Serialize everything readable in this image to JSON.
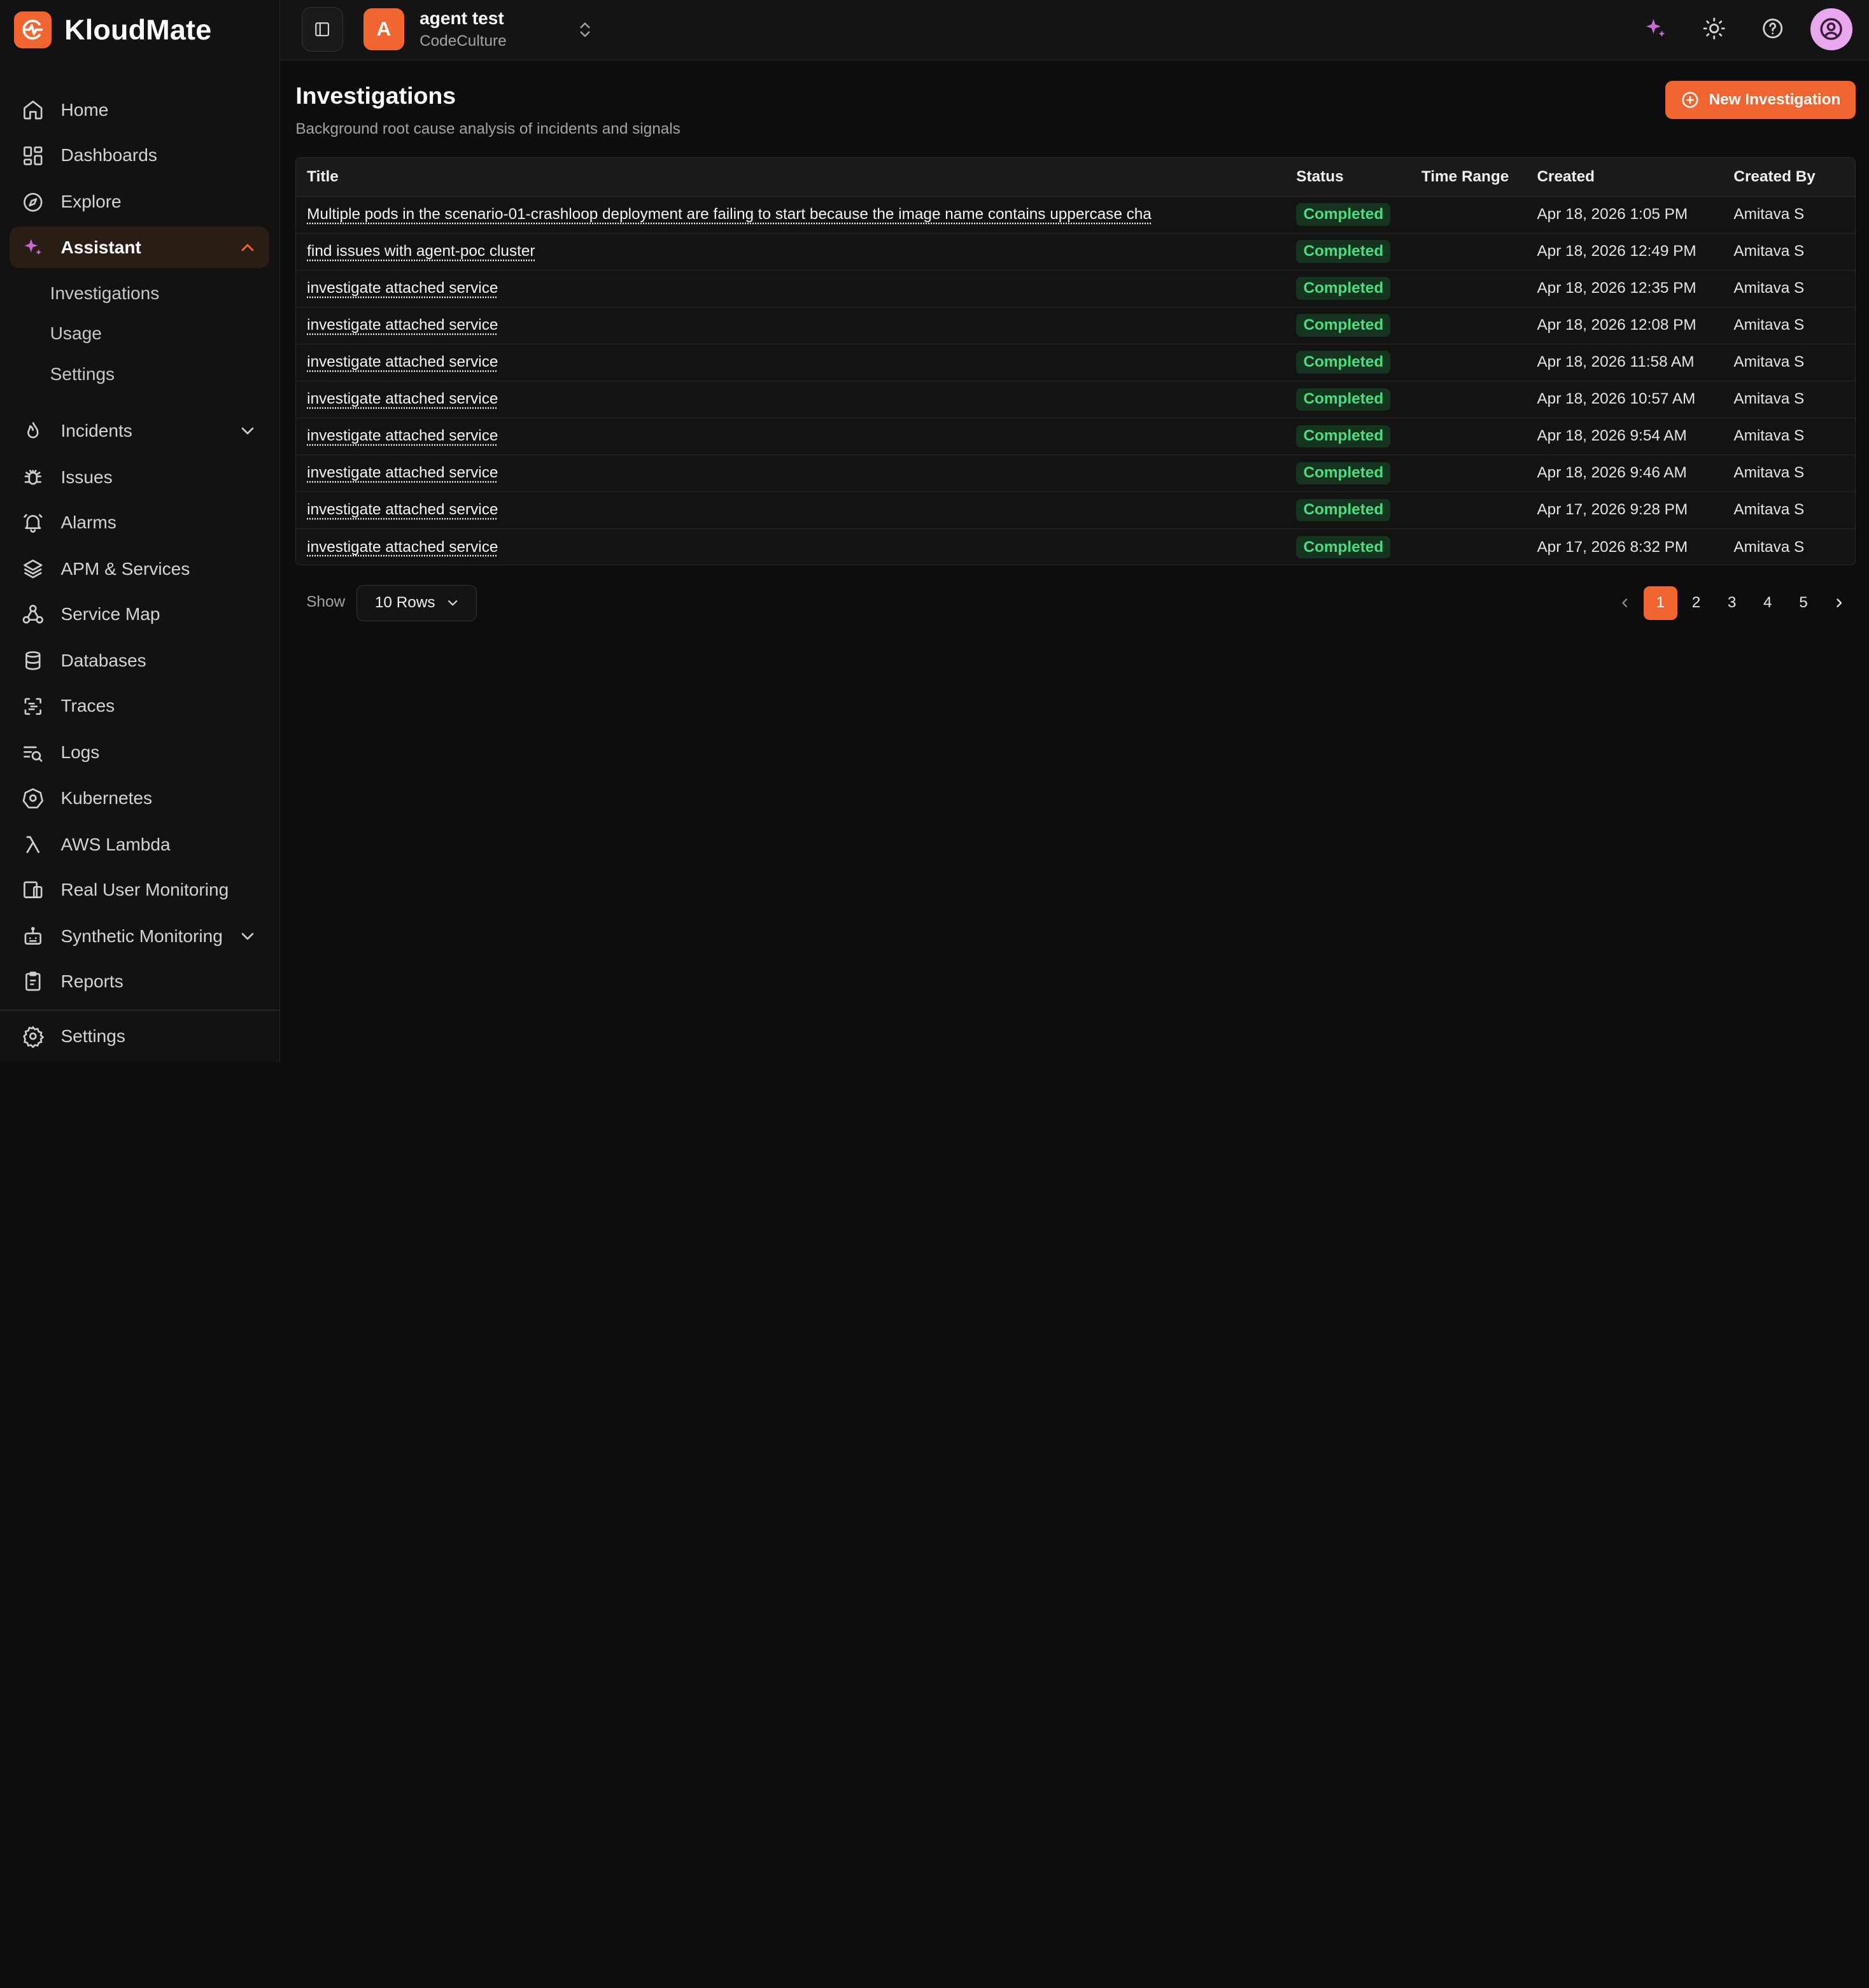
{
  "brand": {
    "name": "KloudMate"
  },
  "sidebar": {
    "items": [
      {
        "label": "Home",
        "icon": "home-icon"
      },
      {
        "label": "Dashboards",
        "icon": "dashboards-icon"
      },
      {
        "label": "Explore",
        "icon": "explore-icon"
      },
      {
        "label": "Assistant",
        "icon": "sparkles-icon"
      },
      {
        "label": "Incidents",
        "icon": "flame-icon"
      },
      {
        "label": "Issues",
        "icon": "bug-icon"
      },
      {
        "label": "Alarms",
        "icon": "alarm-bell-icon"
      },
      {
        "label": "APM & Services",
        "icon": "layers-icon"
      },
      {
        "label": "Service Map",
        "icon": "network-icon"
      },
      {
        "label": "Databases",
        "icon": "database-icon"
      },
      {
        "label": "Traces",
        "icon": "traces-icon"
      },
      {
        "label": "Logs",
        "icon": "logs-icon"
      },
      {
        "label": "Kubernetes",
        "icon": "kubernetes-icon"
      },
      {
        "label": "AWS Lambda",
        "icon": "lambda-icon"
      },
      {
        "label": "Real User Monitoring",
        "icon": "devices-icon"
      },
      {
        "label": "Synthetic Monitoring",
        "icon": "robot-icon"
      },
      {
        "label": "Reports",
        "icon": "clipboard-icon"
      }
    ],
    "assistant_sub": [
      "Investigations",
      "Usage",
      "Settings"
    ],
    "settings_label": "Settings"
  },
  "topbar": {
    "org_initial": "A",
    "org_name": "agent test",
    "org_sub": "CodeCulture"
  },
  "page": {
    "title": "Investigations",
    "subtitle": "Background root cause analysis of incidents and signals",
    "new_button": "New Investigation"
  },
  "table": {
    "headers": [
      "Title",
      "Status",
      "Time Range",
      "Created",
      "Created By"
    ],
    "rows": [
      {
        "title": "Multiple pods in the scenario-01-crashloop deployment are failing to start because the image name contains uppercase cha",
        "status": "Completed",
        "range": "",
        "created": "Apr 18, 2026 1:05 PM",
        "by": "Amitava S"
      },
      {
        "title": "find issues with agent-poc cluster",
        "status": "Completed",
        "range": "",
        "created": "Apr 18, 2026 12:49 PM",
        "by": "Amitava S"
      },
      {
        "title": "investigate attached service",
        "status": "Completed",
        "range": "",
        "created": "Apr 18, 2026 12:35 PM",
        "by": "Amitava S"
      },
      {
        "title": "investigate attached service",
        "status": "Completed",
        "range": "",
        "created": "Apr 18, 2026 12:08 PM",
        "by": "Amitava S"
      },
      {
        "title": "investigate attached service",
        "status": "Completed",
        "range": "",
        "created": "Apr 18, 2026 11:58 AM",
        "by": "Amitava S"
      },
      {
        "title": "investigate attached service",
        "status": "Completed",
        "range": "",
        "created": "Apr 18, 2026 10:57 AM",
        "by": "Amitava S"
      },
      {
        "title": "investigate attached service",
        "status": "Completed",
        "range": "",
        "created": "Apr 18, 2026 9:54 AM",
        "by": "Amitava S"
      },
      {
        "title": "investigate attached service",
        "status": "Completed",
        "range": "",
        "created": "Apr 18, 2026 9:46 AM",
        "by": "Amitava S"
      },
      {
        "title": "investigate attached service",
        "status": "Completed",
        "range": "",
        "created": "Apr 17, 2026 9:28 PM",
        "by": "Amitava S"
      },
      {
        "title": "investigate attached service",
        "status": "Completed",
        "range": "",
        "created": "Apr 17, 2026 8:32 PM",
        "by": "Amitava S"
      }
    ]
  },
  "footer": {
    "show_label": "Show",
    "rows_select": "10 Rows",
    "pages": [
      "1",
      "2",
      "3",
      "4",
      "5"
    ],
    "active_page": "1"
  },
  "colors": {
    "accent": "#f26430",
    "status_completed_bg": "#14341f",
    "status_completed_text": "#4ade80",
    "background": "#0d0d0d",
    "sidebar_bg": "#121212"
  }
}
